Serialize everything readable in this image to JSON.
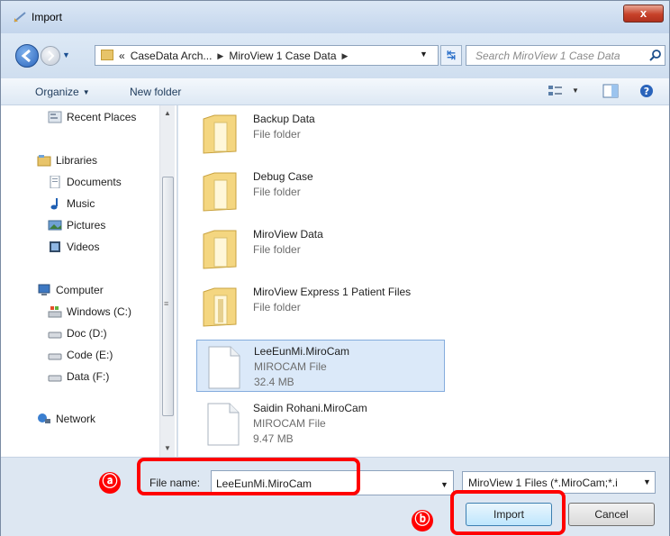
{
  "window": {
    "title": "Import",
    "close_glyph": "x"
  },
  "nav": {
    "breadcrumbs": [
      "CaseData Arch...",
      "MiroView 1 Case Data"
    ],
    "lead_glyph": "«",
    "search_placeholder": "Search MiroView 1 Case Data"
  },
  "toolbar": {
    "organize": "Organize",
    "new_folder": "New folder"
  },
  "sidebar": {
    "items": [
      {
        "label": "Recent Places",
        "icon": "recent-places-icon"
      },
      {
        "label": "Libraries",
        "icon": "libraries-icon"
      },
      {
        "label": "Documents",
        "icon": "documents-icon"
      },
      {
        "label": "Music",
        "icon": "music-icon"
      },
      {
        "label": "Pictures",
        "icon": "pictures-icon"
      },
      {
        "label": "Videos",
        "icon": "videos-icon"
      },
      {
        "label": "Computer",
        "icon": "computer-icon"
      },
      {
        "label": "Windows (C:)",
        "icon": "windows-drive-icon"
      },
      {
        "label": "Doc (D:)",
        "icon": "drive-icon"
      },
      {
        "label": "Code (E:)",
        "icon": "drive-icon"
      },
      {
        "label": "Data (F:)",
        "icon": "drive-icon"
      },
      {
        "label": "Network",
        "icon": "network-icon"
      }
    ]
  },
  "files": [
    {
      "name": "Backup Data",
      "type": "File folder",
      "size": "",
      "kind": "folder",
      "selected": false
    },
    {
      "name": "Debug Case",
      "type": "File folder",
      "size": "",
      "kind": "folder",
      "selected": false
    },
    {
      "name": "MiroView Data",
      "type": "File folder",
      "size": "",
      "kind": "folder",
      "selected": false
    },
    {
      "name": "MiroView Express 1 Patient Files",
      "type": "File folder",
      "size": "",
      "kind": "folder",
      "selected": false
    },
    {
      "name": "LeeEunMi.MiroCam",
      "type": "MIROCAM File",
      "size": "32.4 MB",
      "kind": "file",
      "selected": true
    },
    {
      "name": "Saidin Rohani.MiroCam",
      "type": "MIROCAM File",
      "size": "9.47 MB",
      "kind": "file",
      "selected": false
    }
  ],
  "bottom": {
    "file_name_label": "File name:",
    "file_name_value": "LeeEunMi.MiroCam",
    "filter_value": "MiroView 1 Files (*.MiroCam;*.i",
    "import_label": "Import",
    "cancel_label": "Cancel"
  },
  "annotations": {
    "a": "ⓐ",
    "b": "ⓑ",
    "color": "#ff0000"
  },
  "colors": {
    "selection": "#dbe9f9",
    "chrome": "#d6e3f1",
    "accent": "#2a64bb"
  }
}
